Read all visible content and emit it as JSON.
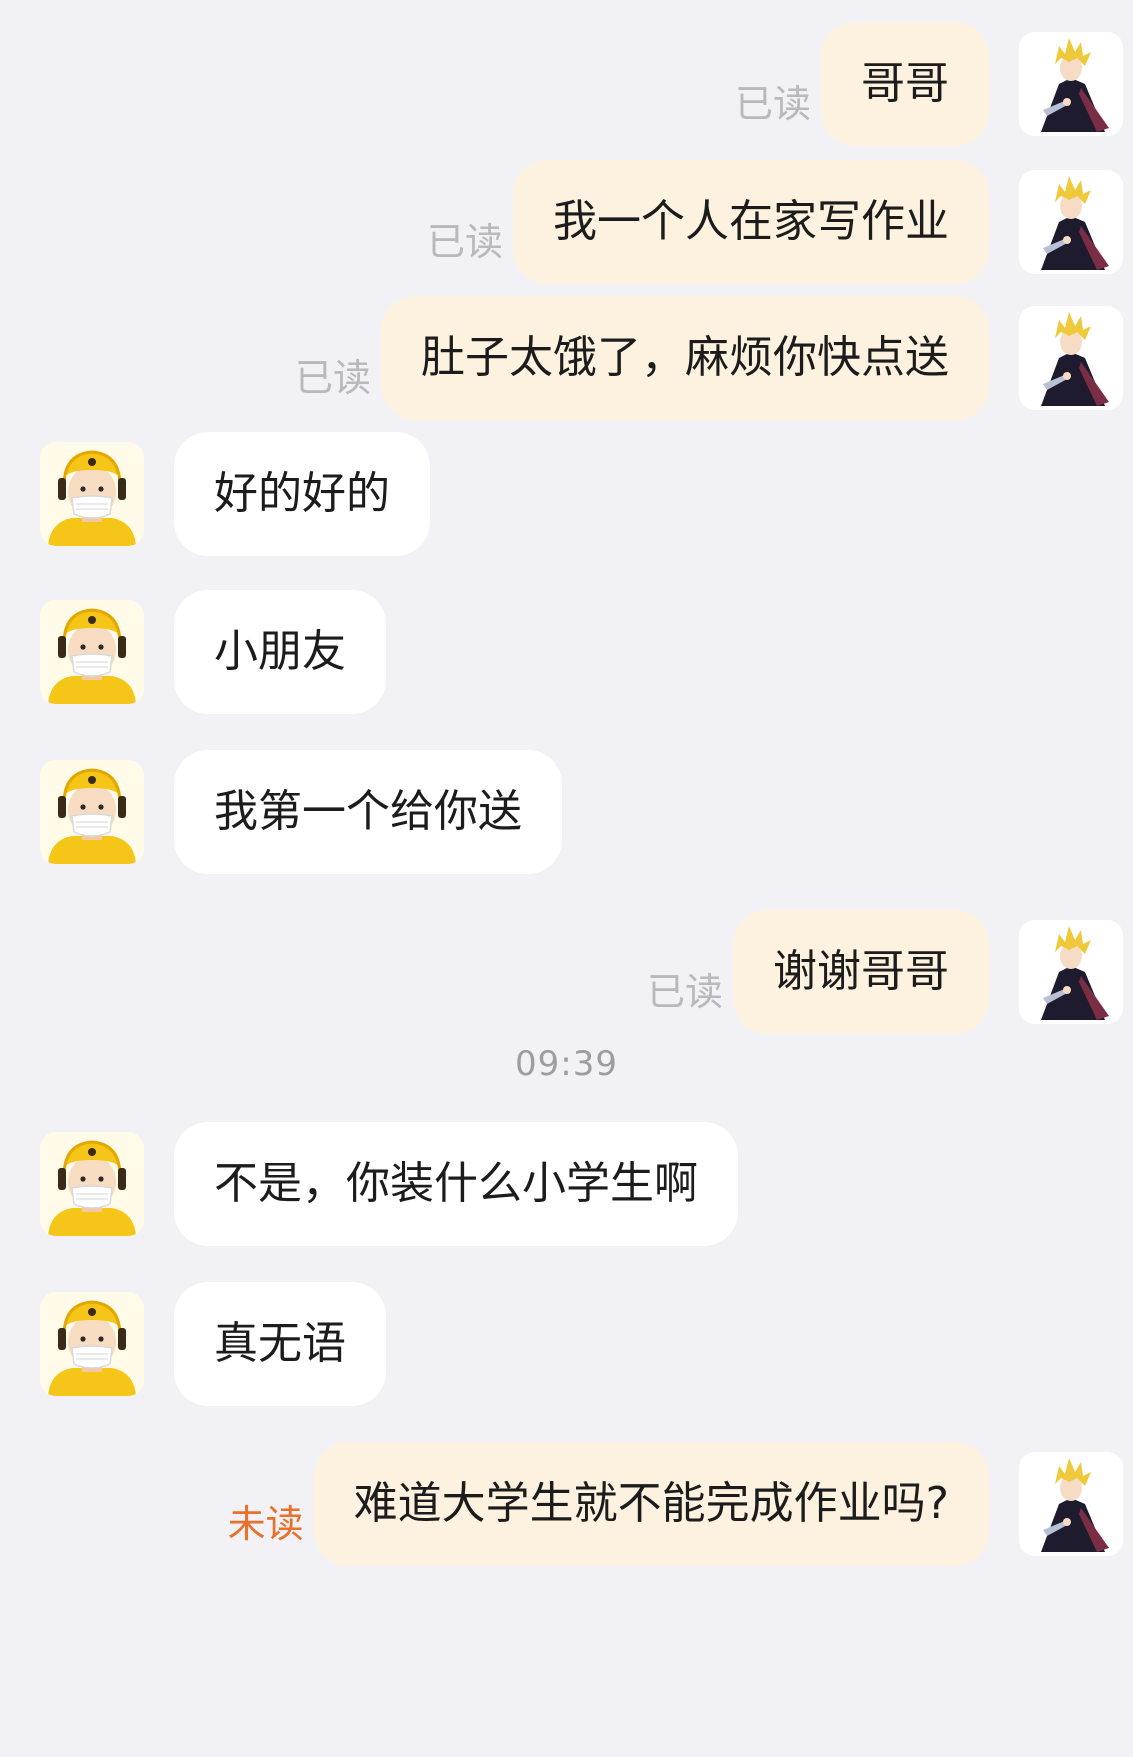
{
  "messages": [
    {
      "side": "out",
      "text": "哥哥",
      "status": "已读"
    },
    {
      "side": "out",
      "text": "我一个人在家写作业",
      "status": "已读"
    },
    {
      "side": "out",
      "text": "肚子太饿了，麻烦你快点送",
      "status": "已读"
    },
    {
      "side": "in",
      "text": "好的好的"
    },
    {
      "side": "in",
      "text": "小朋友"
    },
    {
      "side": "in",
      "text": "我第一个给你送"
    },
    {
      "side": "out",
      "text": "谢谢哥哥",
      "status": "已读"
    },
    {
      "side": "in",
      "text": "不是，你装什么小学生啊"
    },
    {
      "side": "in",
      "text": "真无语"
    },
    {
      "side": "out",
      "text": "难道大学生就不能完成作业吗?",
      "status": "未读"
    }
  ],
  "timestamp": "09:39",
  "colors": {
    "background": "#f2f1f6",
    "outgoing_bubble": "#fdf2df",
    "incoming_bubble": "#ffffff",
    "read_status": "#b9b9bd",
    "unread_status": "#e8712b",
    "courier_helmet": "#f5c518"
  },
  "icons": {
    "self_avatar": "anime-boy-avatar-icon",
    "courier_avatar": "delivery-courier-avatar-icon"
  }
}
